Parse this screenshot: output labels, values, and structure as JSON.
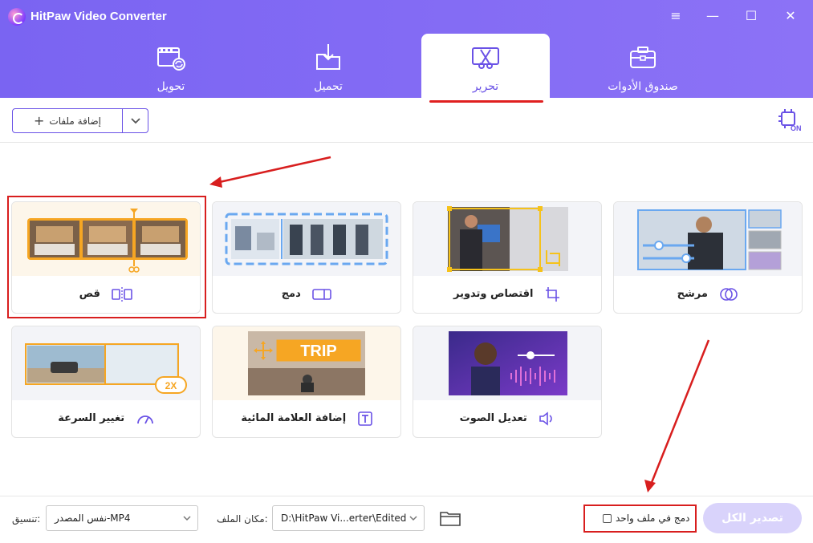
{
  "app": {
    "title": "HitPaw Video Converter"
  },
  "window_controls": {
    "menu": "≡",
    "minimize": "—",
    "maximize": "☐",
    "close": "✕"
  },
  "nav": {
    "tabs": [
      {
        "label": "تحويل"
      },
      {
        "label": "تحميل"
      },
      {
        "label": "تحرير"
      },
      {
        "label": "صندوق الأدوات"
      }
    ]
  },
  "toolbar": {
    "add_files": "إضافة ملفات"
  },
  "tools": {
    "trim": "قص",
    "merge": "دمج",
    "crop_rotate": "اقتصاص وتدوير",
    "filter": "مرشح",
    "speed": "تغيير السرعة",
    "watermark": "إضافة العلامة المائية",
    "audio": "تعديل الصوت",
    "speed_badge": "2X",
    "watermark_text": "TRIP"
  },
  "bottom": {
    "format_label": "تنسيق:",
    "format_value": "نفس المصدر-MP4",
    "location_label": "مكان الملف:",
    "location_value": "D:\\HitPaw Vi...erter\\Edited",
    "merge_label": "دمج في ملف واحد",
    "export_label": "تصدير الكل"
  },
  "colors": {
    "accent": "#7a64f2",
    "annotation": "#d81e1e"
  }
}
